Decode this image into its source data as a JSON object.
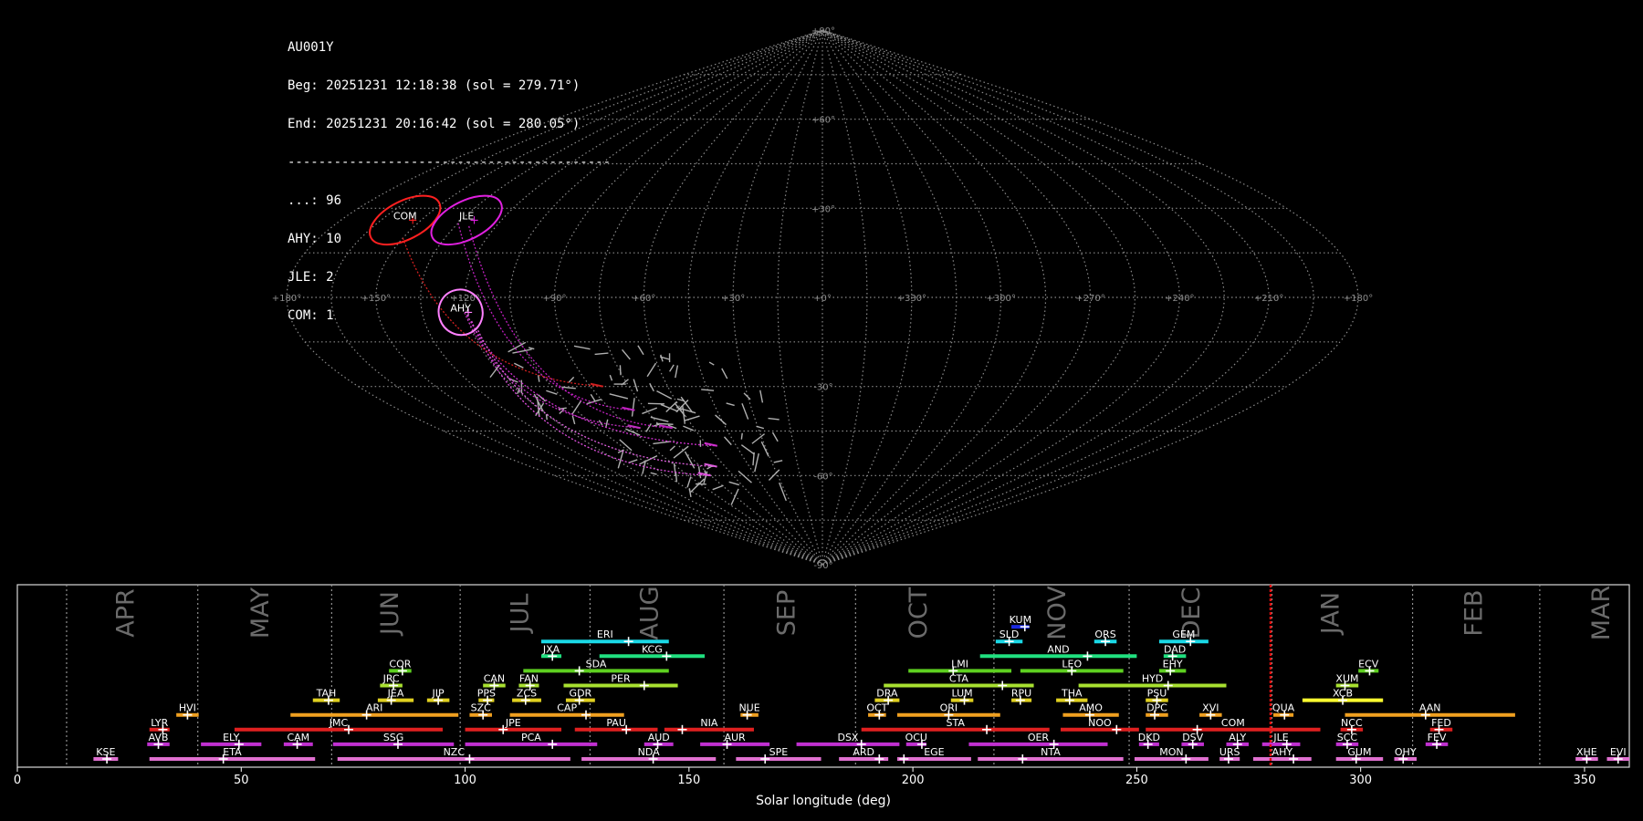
{
  "header": {
    "station": "AU001Y",
    "begin": "Beg: 20251231 12:18:38 (sol = 279.71°)",
    "end": "End: 20251231 20:16:42 (sol = 280.05°)",
    "separator": "------------------------------------------",
    "counts": [
      {
        "label": "...: 96"
      },
      {
        "label": "AHY: 10"
      },
      {
        "label": "JLE: 2"
      },
      {
        "label": "COM: 1"
      }
    ]
  },
  "chart_data": [
    {
      "type": "scatter",
      "projection": "sinusoidal",
      "lon_range": [
        180,
        -180
      ],
      "lat_range": [
        -90,
        90
      ],
      "grid": true,
      "lon_tick_labels": [
        "+180°",
        "+150°",
        "+120°",
        "+90°",
        "+60°",
        "+30°",
        "+0°",
        "+330°",
        "+300°",
        "+270°",
        "+240°",
        "+210°",
        "+180°"
      ],
      "lat_tick_labels": [
        "+90°",
        "+60°",
        "+30°",
        "-30°",
        "-60°",
        "-90°"
      ],
      "radiants": [
        {
          "name": "COM",
          "lon": 156,
          "lat": 26,
          "color": "#ff2020"
        },
        {
          "name": "JLE",
          "lon": 133,
          "lat": 26,
          "color": "#e020e0"
        },
        {
          "name": "AHY",
          "lon": 122,
          "lat": -5,
          "color": "#ff80ff"
        }
      ],
      "meteor_track_count": 109
    },
    {
      "type": "bar",
      "title": "",
      "xlabel": "Solar longitude (deg)",
      "xlim": [
        0,
        360
      ],
      "x_ticks": [
        0,
        50,
        100,
        150,
        200,
        250,
        300,
        350
      ],
      "current_sol": 279.88,
      "months": [
        {
          "label": "APR",
          "start": 11.0,
          "center": 24.5
        },
        {
          "label": "MAY",
          "start": 40.3,
          "center": 54.5
        },
        {
          "label": "JUN",
          "start": 70.2,
          "center": 83.5
        },
        {
          "label": "JUL",
          "start": 98.9,
          "center": 112.5
        },
        {
          "label": "AUG",
          "start": 127.9,
          "center": 141.5
        },
        {
          "label": "SEP",
          "start": 157.8,
          "center": 172.0
        },
        {
          "label": "OCT",
          "start": 187.2,
          "center": 201.5
        },
        {
          "label": "NOV",
          "start": 218.1,
          "center": 232.5
        },
        {
          "label": "DEC",
          "start": 248.3,
          "center": 262.5
        },
        {
          "label": "JAN",
          "start": 280.2,
          "center": 293.5
        },
        {
          "label": "FEB",
          "start": 311.6,
          "center": 325.5
        },
        {
          "label": "MAR",
          "start": 340.0,
          "center": 354.0
        }
      ],
      "showers": [
        {
          "code": "KUM",
          "start": 222.0,
          "end": 226.0,
          "peak": 225.0,
          "row": 10,
          "color": "#1b2ae0"
        },
        {
          "code": "ERI",
          "start": 117.0,
          "end": 145.5,
          "peak": 136.5,
          "row": 9,
          "color": "#1ad8e6"
        },
        {
          "code": "SLD",
          "start": 218.5,
          "end": 224.5,
          "peak": 221.5,
          "row": 9,
          "color": "#1ad8e6"
        },
        {
          "code": "ORS",
          "start": 240.5,
          "end": 245.5,
          "peak": 243.0,
          "row": 9,
          "color": "#1ad8e6"
        },
        {
          "code": "GEM",
          "start": 255.0,
          "end": 266.0,
          "peak": 262.0,
          "row": 9,
          "color": "#1ad8e6"
        },
        {
          "code": "JXA",
          "start": 117.0,
          "end": 121.5,
          "peak": 119.5,
          "row": 8,
          "color": "#20e080"
        },
        {
          "code": "KCG",
          "start": 130.0,
          "end": 153.5,
          "peak": 145.0,
          "row": 8,
          "color": "#20e080"
        },
        {
          "code": "AND",
          "start": 215.0,
          "end": 250.0,
          "peak": 239.0,
          "row": 8,
          "color": "#20e080"
        },
        {
          "code": "DAD",
          "start": 256.0,
          "end": 261.0,
          "peak": 258.0,
          "row": 8,
          "color": "#20e080"
        },
        {
          "code": "COR",
          "start": 83.0,
          "end": 88.0,
          "peak": 86.0,
          "row": 7,
          "color": "#5ed020"
        },
        {
          "code": "SDA",
          "start": 113.0,
          "end": 145.5,
          "peak": 125.5,
          "row": 7,
          "color": "#5ed020"
        },
        {
          "code": "LMI",
          "start": 199.0,
          "end": 222.0,
          "peak": 209.0,
          "row": 7,
          "color": "#5ed020"
        },
        {
          "code": "LEO",
          "start": 224.0,
          "end": 247.0,
          "peak": 235.5,
          "row": 7,
          "color": "#5ed020"
        },
        {
          "code": "EHY",
          "start": 255.0,
          "end": 261.0,
          "peak": 257.5,
          "row": 7,
          "color": "#5ed020"
        },
        {
          "code": "ECV",
          "start": 299.5,
          "end": 304.0,
          "peak": 302.0,
          "row": 7,
          "color": "#5ed020"
        },
        {
          "code": "JRC",
          "start": 81.0,
          "end": 86.0,
          "peak": 84.0,
          "row": 6,
          "color": "#a8e030"
        },
        {
          "code": "CAN",
          "start": 104.0,
          "end": 109.0,
          "peak": 106.5,
          "row": 6,
          "color": "#a8e030"
        },
        {
          "code": "FAN",
          "start": 112.0,
          "end": 116.5,
          "peak": 114.5,
          "row": 6,
          "color": "#a8e030"
        },
        {
          "code": "PER",
          "start": 122.0,
          "end": 147.5,
          "peak": 140.0,
          "row": 6,
          "color": "#a8e030"
        },
        {
          "code": "CTA",
          "start": 193.5,
          "end": 227.0,
          "peak": 220.0,
          "row": 6,
          "color": "#a8e030"
        },
        {
          "code": "HYD",
          "start": 237.0,
          "end": 270.0,
          "peak": 257.0,
          "row": 6,
          "color": "#a8e030"
        },
        {
          "code": "XUM",
          "start": 294.5,
          "end": 299.5,
          "peak": 296.5,
          "row": 6,
          "color": "#a8e030"
        },
        {
          "code": "TAH",
          "start": 66.0,
          "end": 72.0,
          "peak": 69.5,
          "row": 5,
          "color": "#e0d020"
        },
        {
          "code": "JEA",
          "start": 80.5,
          "end": 88.5,
          "peak": 83.5,
          "row": 5,
          "color": "#e0d020"
        },
        {
          "code": "JIP",
          "start": 91.5,
          "end": 96.5,
          "peak": 94.0,
          "row": 5,
          "color": "#e0d020"
        },
        {
          "code": "PPS",
          "start": 103.0,
          "end": 106.5,
          "peak": 105.0,
          "row": 5,
          "color": "#e0d020"
        },
        {
          "code": "ZCS",
          "start": 110.5,
          "end": 117.0,
          "peak": 113.5,
          "row": 5,
          "color": "#e0d020"
        },
        {
          "code": "GDR",
          "start": 122.5,
          "end": 129.0,
          "peak": 125.5,
          "row": 5,
          "color": "#e0d020"
        },
        {
          "code": "DRA",
          "start": 191.5,
          "end": 197.0,
          "peak": 194.5,
          "row": 5,
          "color": "#e0d020"
        },
        {
          "code": "LUM",
          "start": 208.5,
          "end": 213.5,
          "peak": 211.5,
          "row": 5,
          "color": "#e0d020"
        },
        {
          "code": "RPU",
          "start": 222.0,
          "end": 226.5,
          "peak": 224.0,
          "row": 5,
          "color": "#e0d020"
        },
        {
          "code": "THA",
          "start": 232.0,
          "end": 239.0,
          "peak": 235.0,
          "row": 5,
          "color": "#e0d020"
        },
        {
          "code": "PSU",
          "start": 252.0,
          "end": 257.0,
          "peak": 254.5,
          "row": 5,
          "color": "#e0d020"
        },
        {
          "code": "XCB",
          "start": 287.0,
          "end": 305.0,
          "peak": 296.0,
          "row": 5,
          "color": "#ffff30"
        },
        {
          "code": "HVI",
          "start": 35.5,
          "end": 40.5,
          "peak": 38.0,
          "row": 4,
          "color": "#f0a020"
        },
        {
          "code": "ARI",
          "start": 61.0,
          "end": 98.5,
          "peak": 78.0,
          "row": 4,
          "color": "#f0a020"
        },
        {
          "code": "SZC",
          "start": 101.0,
          "end": 106.0,
          "peak": 104.0,
          "row": 4,
          "color": "#f0a020"
        },
        {
          "code": "CAP",
          "start": 110.0,
          "end": 135.5,
          "peak": 127.0,
          "row": 4,
          "color": "#f0a020"
        },
        {
          "code": "NUE",
          "start": 161.5,
          "end": 165.5,
          "peak": 163.0,
          "row": 4,
          "color": "#f0a020"
        },
        {
          "code": "OCT",
          "start": 190.0,
          "end": 194.0,
          "peak": 192.5,
          "row": 4,
          "color": "#f0a020"
        },
        {
          "code": "ORI",
          "start": 196.5,
          "end": 219.5,
          "peak": 208.0,
          "row": 4,
          "color": "#f0a020"
        },
        {
          "code": "AMO",
          "start": 233.5,
          "end": 246.0,
          "peak": 239.5,
          "row": 4,
          "color": "#f0a020"
        },
        {
          "code": "DPC",
          "start": 252.0,
          "end": 257.0,
          "peak": 254.0,
          "row": 4,
          "color": "#f0a020"
        },
        {
          "code": "XVI",
          "start": 264.0,
          "end": 269.0,
          "peak": 266.5,
          "row": 4,
          "color": "#f0a020"
        },
        {
          "code": "QUA",
          "start": 280.5,
          "end": 285.0,
          "peak": 283.0,
          "row": 4,
          "color": "#f0a020"
        },
        {
          "code": "AAN",
          "start": 296.5,
          "end": 334.5,
          "peak": 314.5,
          "row": 4,
          "color": "#f0a020"
        },
        {
          "code": "LYR",
          "start": 29.5,
          "end": 34.0,
          "peak": 32.5,
          "row": 3,
          "color": "#e02020"
        },
        {
          "code": "JMC",
          "start": 48.5,
          "end": 95.0,
          "peak": 74.0,
          "row": 3,
          "color": "#e02020"
        },
        {
          "code": "JPE",
          "start": 100.0,
          "end": 121.5,
          "peak": 108.5,
          "row": 3,
          "color": "#e02020"
        },
        {
          "code": "PAU",
          "start": 124.5,
          "end": 143.0,
          "peak": 136.0,
          "row": 3,
          "color": "#e02020"
        },
        {
          "code": "NIA",
          "start": 144.5,
          "end": 164.5,
          "peak": 148.5,
          "row": 3,
          "color": "#e02020"
        },
        {
          "code": "STA",
          "start": 188.5,
          "end": 230.5,
          "peak": 216.5,
          "row": 3,
          "color": "#e02020"
        },
        {
          "code": "NOO",
          "start": 233.0,
          "end": 250.5,
          "peak": 245.5,
          "row": 3,
          "color": "#e02020"
        },
        {
          "code": "COM",
          "start": 252.0,
          "end": 291.0,
          "peak": 263.5,
          "row": 3,
          "color": "#e02020"
        },
        {
          "code": "NCC",
          "start": 295.5,
          "end": 300.5,
          "peak": 298.0,
          "row": 3,
          "color": "#e02020"
        },
        {
          "code": "FED",
          "start": 315.5,
          "end": 320.5,
          "peak": 317.5,
          "row": 3,
          "color": "#e02020"
        },
        {
          "code": "AVB",
          "start": 29.0,
          "end": 34.0,
          "peak": 31.5,
          "row": 2,
          "color": "#c030d0"
        },
        {
          "code": "ELY",
          "start": 41.0,
          "end": 54.5,
          "peak": 49.5,
          "row": 2,
          "color": "#c030d0"
        },
        {
          "code": "CAM",
          "start": 59.5,
          "end": 66.0,
          "peak": 62.5,
          "row": 2,
          "color": "#c030d0"
        },
        {
          "code": "SSG",
          "start": 70.5,
          "end": 97.5,
          "peak": 85.0,
          "row": 2,
          "color": "#c030d0"
        },
        {
          "code": "PCA",
          "start": 100.0,
          "end": 129.5,
          "peak": 119.5,
          "row": 2,
          "color": "#c030d0"
        },
        {
          "code": "AUD",
          "start": 140.0,
          "end": 146.5,
          "peak": 143.0,
          "row": 2,
          "color": "#c030d0"
        },
        {
          "code": "AUR",
          "start": 152.5,
          "end": 168.0,
          "peak": 158.5,
          "row": 2,
          "color": "#c030d0"
        },
        {
          "code": "DSX",
          "start": 174.0,
          "end": 197.0,
          "peak": 188.5,
          "row": 2,
          "color": "#c030d0"
        },
        {
          "code": "OCU",
          "start": 198.5,
          "end": 203.0,
          "peak": 202.0,
          "row": 2,
          "color": "#c030d0"
        },
        {
          "code": "OER",
          "start": 212.5,
          "end": 243.5,
          "peak": 231.5,
          "row": 2,
          "color": "#c030d0"
        },
        {
          "code": "DKD",
          "start": 250.5,
          "end": 255.0,
          "peak": 252.5,
          "row": 2,
          "color": "#c030d0"
        },
        {
          "code": "DSV",
          "start": 260.0,
          "end": 265.0,
          "peak": 262.5,
          "row": 2,
          "color": "#c030d0"
        },
        {
          "code": "ALY",
          "start": 270.0,
          "end": 275.0,
          "peak": 272.5,
          "row": 2,
          "color": "#c030d0"
        },
        {
          "code": "JLE",
          "start": 278.0,
          "end": 286.5,
          "peak": 283.5,
          "row": 2,
          "color": "#c030d0"
        },
        {
          "code": "SCC",
          "start": 294.5,
          "end": 299.5,
          "peak": 297.0,
          "row": 2,
          "color": "#c030d0"
        },
        {
          "code": "FEV",
          "start": 314.5,
          "end": 319.5,
          "peak": 317.0,
          "row": 2,
          "color": "#c030d0"
        },
        {
          "code": "KSE",
          "start": 17.0,
          "end": 22.5,
          "peak": 20.0,
          "row": 1,
          "color": "#e070d0"
        },
        {
          "code": "ETA",
          "start": 29.5,
          "end": 66.5,
          "peak": 46.0,
          "row": 1,
          "color": "#e070d0"
        },
        {
          "code": "NZC",
          "start": 71.5,
          "end": 123.5,
          "peak": 101.0,
          "row": 1,
          "color": "#e070d0"
        },
        {
          "code": "NDA",
          "start": 126.0,
          "end": 156.0,
          "peak": 142.0,
          "row": 1,
          "color": "#e070d0"
        },
        {
          "code": "SPE",
          "start": 160.5,
          "end": 179.5,
          "peak": 167.0,
          "row": 1,
          "color": "#e070d0"
        },
        {
          "code": "ARD",
          "start": 183.5,
          "end": 194.5,
          "peak": 192.5,
          "row": 1,
          "color": "#e070d0"
        },
        {
          "code": "EGE",
          "start": 196.5,
          "end": 213.0,
          "peak": 198.0,
          "row": 1,
          "color": "#e070d0"
        },
        {
          "code": "NTA",
          "start": 214.5,
          "end": 247.0,
          "peak": 224.5,
          "row": 1,
          "color": "#e070d0"
        },
        {
          "code": "MON",
          "start": 249.5,
          "end": 266.0,
          "peak": 261.0,
          "row": 1,
          "color": "#e070d0"
        },
        {
          "code": "URS",
          "start": 268.5,
          "end": 273.0,
          "peak": 270.5,
          "row": 1,
          "color": "#e070d0"
        },
        {
          "code": "AHY",
          "start": 276.0,
          "end": 289.0,
          "peak": 285.0,
          "row": 1,
          "color": "#e070d0"
        },
        {
          "code": "GUM",
          "start": 294.5,
          "end": 305.0,
          "peak": 299.0,
          "row": 1,
          "color": "#e070d0"
        },
        {
          "code": "OHY",
          "start": 307.5,
          "end": 312.5,
          "peak": 309.5,
          "row": 1,
          "color": "#e070d0"
        },
        {
          "code": "XHE",
          "start": 348.0,
          "end": 353.0,
          "peak": 350.5,
          "row": 1,
          "color": "#e070d0"
        },
        {
          "code": "EVI",
          "start": 355.0,
          "end": 360.0,
          "peak": 357.5,
          "row": 1,
          "color": "#e070d0"
        }
      ]
    }
  ]
}
